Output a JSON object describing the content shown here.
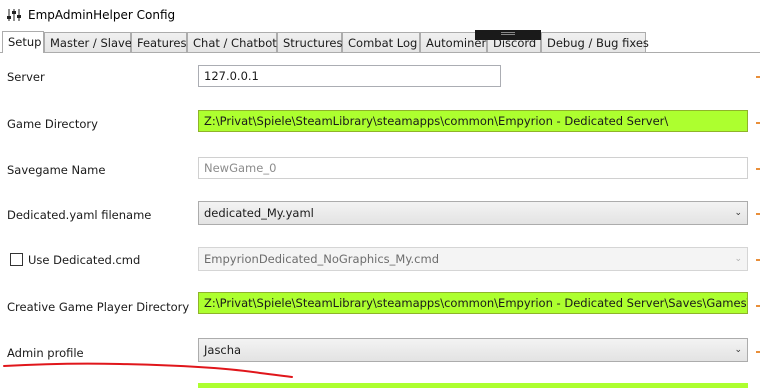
{
  "window": {
    "title": "EmpAdminHelper Config",
    "icon": "tuning-sliders-icon"
  },
  "tabs": [
    {
      "label": "Setup",
      "active": true
    },
    {
      "label": "Master / Slave"
    },
    {
      "label": "Features"
    },
    {
      "label": "Chat / Chatbot"
    },
    {
      "label": "Structures"
    },
    {
      "label": "Combat Log"
    },
    {
      "label": "Autominer"
    },
    {
      "label": "Discord"
    },
    {
      "label": "Debug / Bug fixes"
    }
  ],
  "setup": {
    "server": {
      "label": "Server",
      "value": "127.0.0.1"
    },
    "game_directory": {
      "label": "Game Directory",
      "value": "Z:\\Privat\\Spiele\\SteamLibrary\\steamapps\\common\\Empyrion - Dedicated Server\\"
    },
    "savegame_name": {
      "label": "Savegame Name",
      "value": "NewGame_0"
    },
    "dedicated_yaml": {
      "label": "Dedicated.yaml filename",
      "value": "dedicated_My.yaml"
    },
    "use_dedicated_cmd": {
      "label": "Use Dedicated.cmd",
      "checked": false,
      "value": "EmpyrionDedicated_NoGraphics_My.cmd"
    },
    "creative_dir": {
      "label": "Creative Game Player Directory",
      "value": "Z:\\Privat\\Spiele\\SteamLibrary\\steamapps\\common\\Empyrion - Dedicated Server\\Saves\\Games\\"
    },
    "admin_profile": {
      "label": "Admin profile",
      "value": "Jascha"
    }
  },
  "colors": {
    "highlight_green": "#adff2f",
    "annotation_red": "#e0161b",
    "side_dash": "#e98f3a"
  }
}
